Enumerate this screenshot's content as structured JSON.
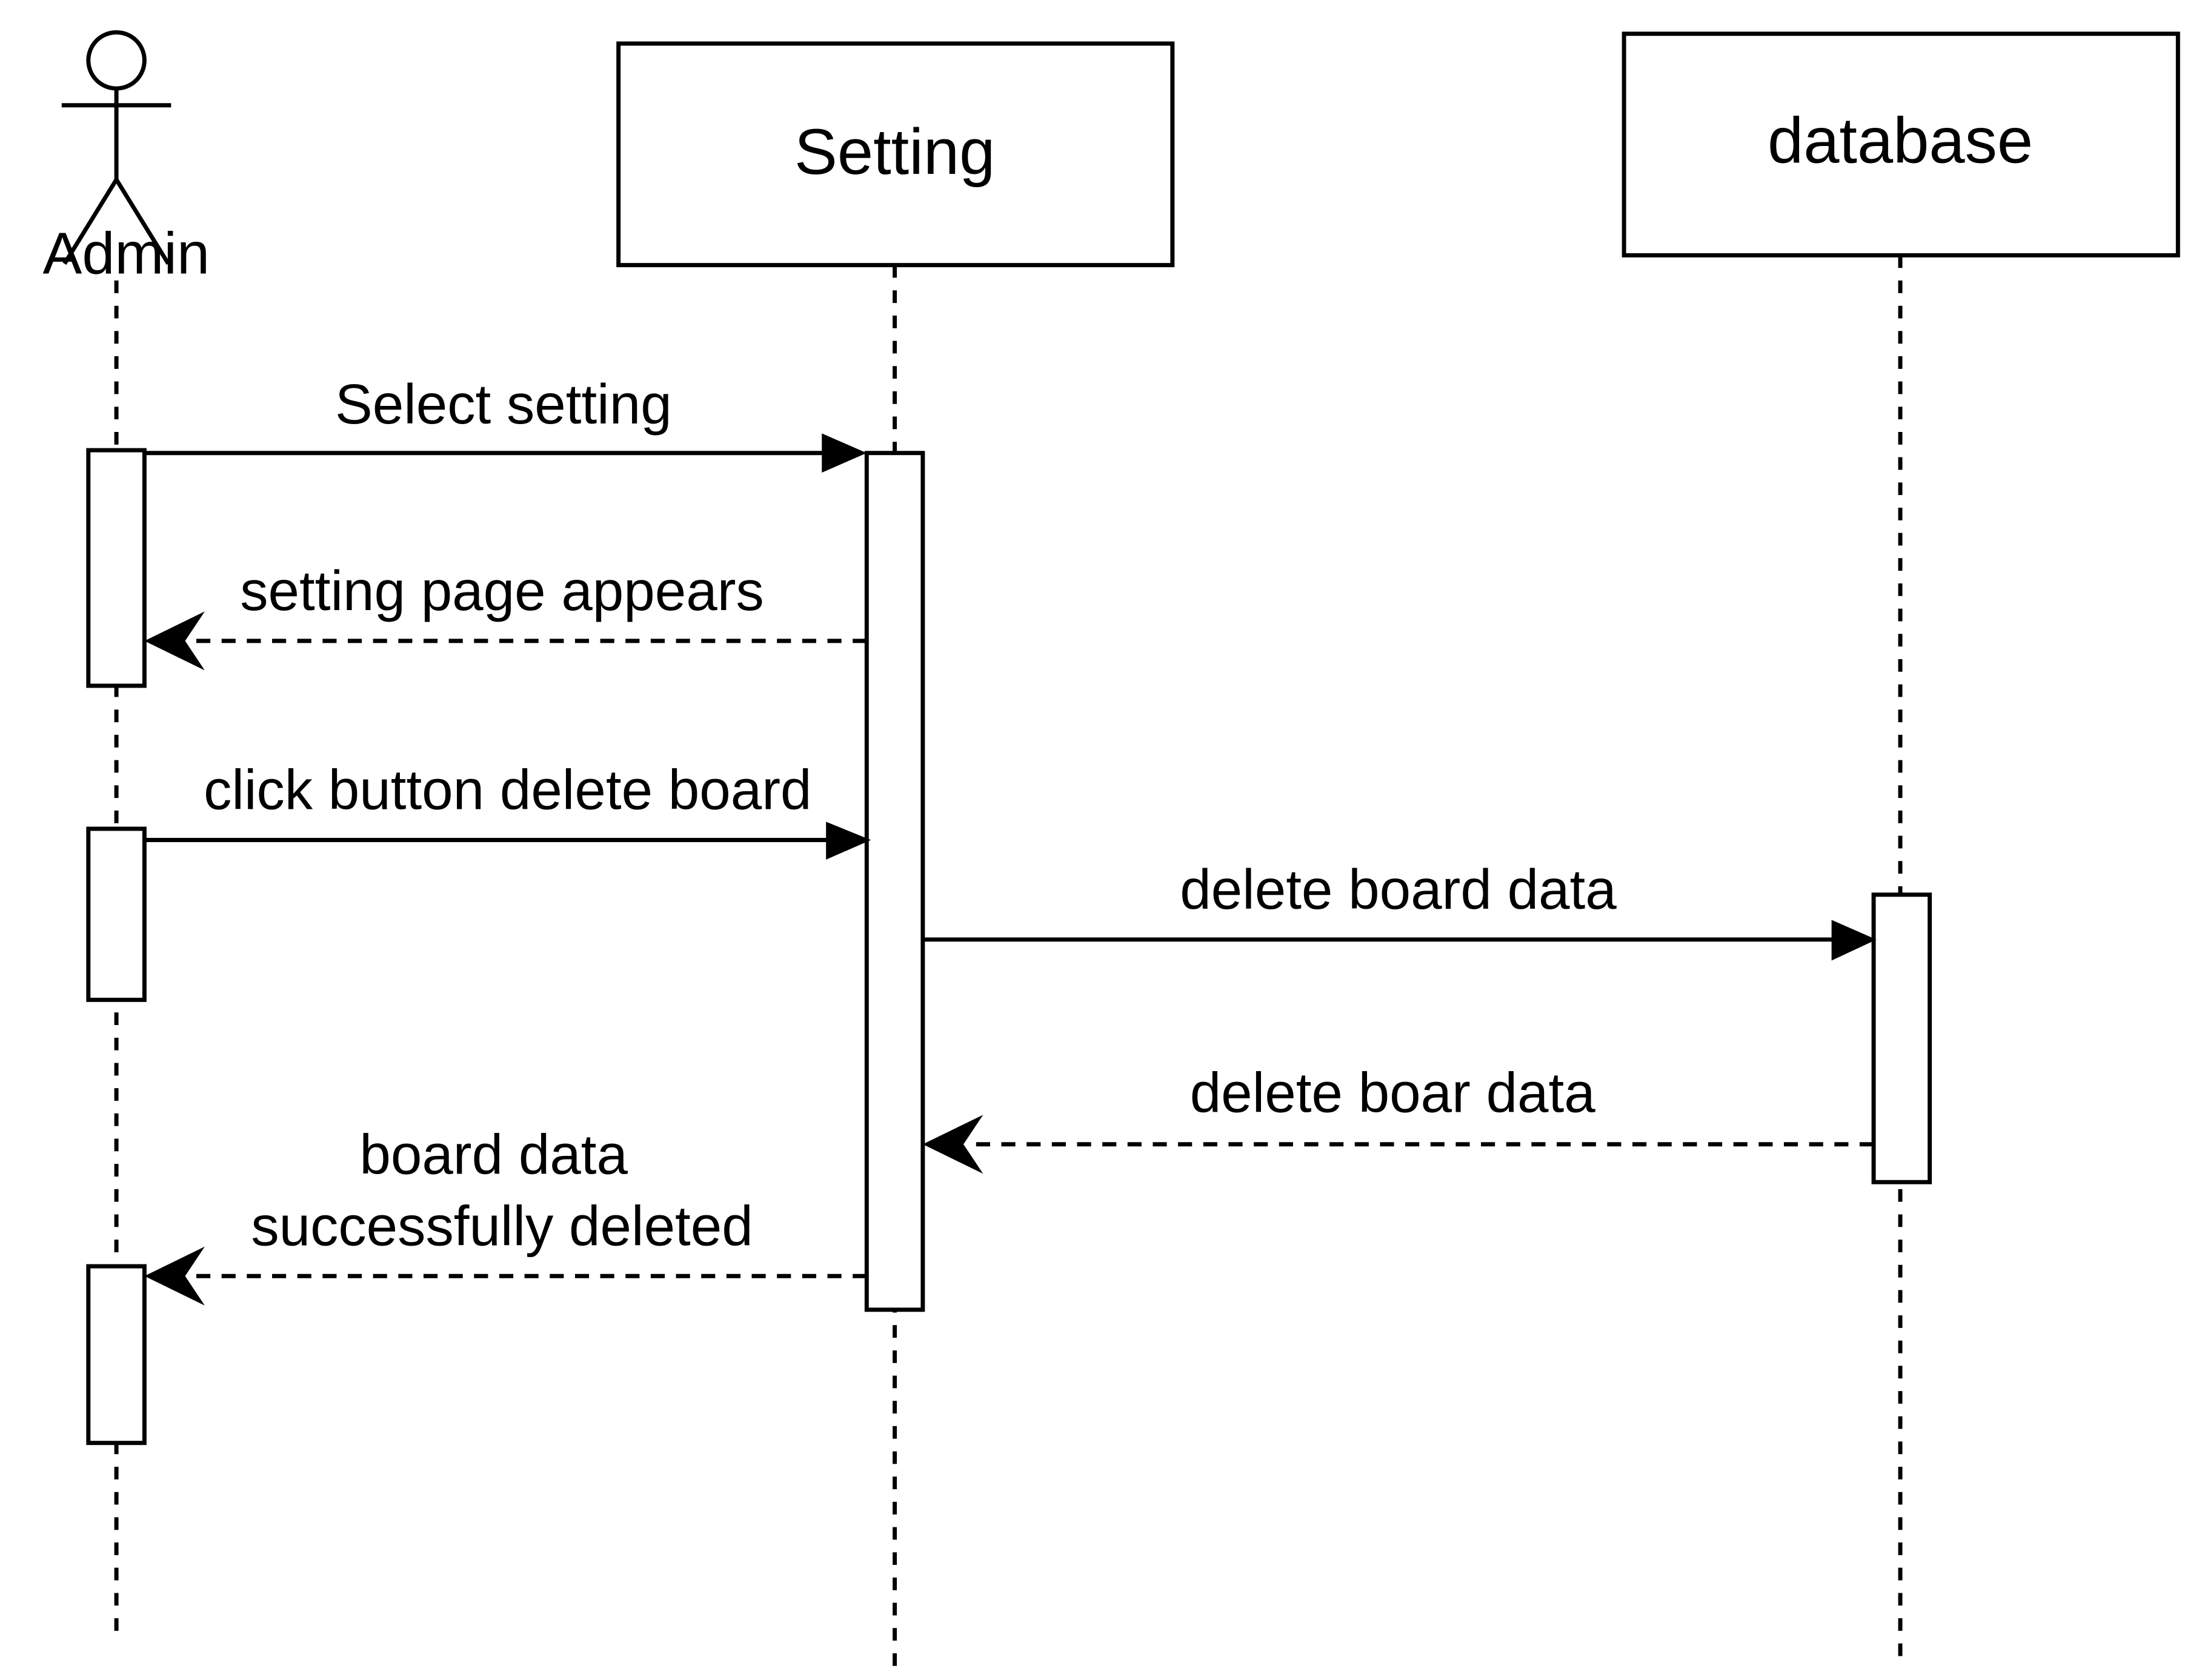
{
  "diagram": {
    "type": "sequence",
    "participants": [
      {
        "id": "admin",
        "label": "Admin",
        "kind": "actor"
      },
      {
        "id": "setting",
        "label": "Setting",
        "kind": "object"
      },
      {
        "id": "database",
        "label": "database",
        "kind": "object"
      }
    ],
    "messages": [
      {
        "from": "admin",
        "to": "setting",
        "label": "Select setting",
        "style": "sync"
      },
      {
        "from": "setting",
        "to": "admin",
        "label": "setting page appears",
        "style": "return"
      },
      {
        "from": "admin",
        "to": "setting",
        "label": "click button delete board",
        "style": "sync"
      },
      {
        "from": "setting",
        "to": "database",
        "label": "delete board data",
        "style": "sync"
      },
      {
        "from": "database",
        "to": "setting",
        "label": "delete boar data",
        "style": "return"
      },
      {
        "from": "setting",
        "to": "admin",
        "label_lines": [
          "board data",
          "successfully deleted"
        ],
        "style": "return"
      }
    ]
  }
}
